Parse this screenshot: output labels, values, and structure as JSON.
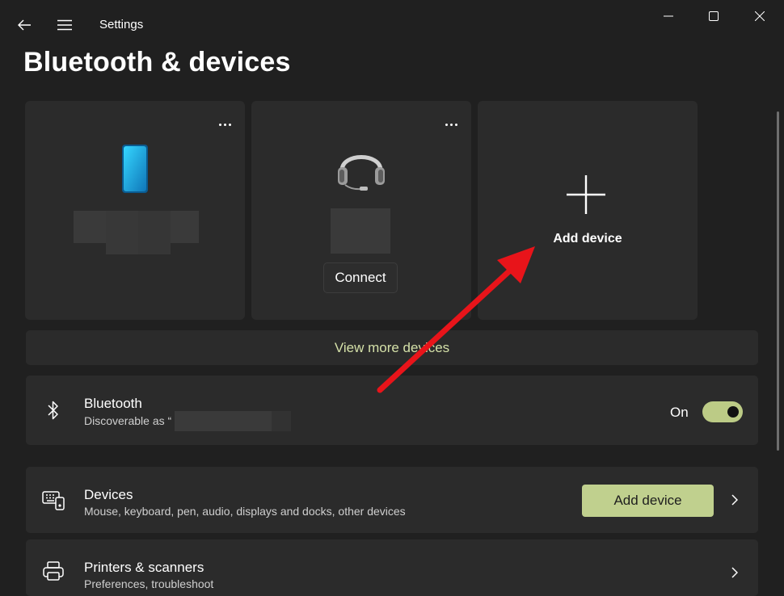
{
  "window": {
    "app_title": "Settings",
    "controls": [
      "minimize-icon",
      "maximize-icon",
      "close-icon"
    ]
  },
  "page": {
    "title": "Bluetooth & devices"
  },
  "device_cards": [
    {
      "type": "phone",
      "icon": "phone-icon",
      "name": ""
    },
    {
      "type": "headset",
      "icon": "headset-icon",
      "name": "",
      "action": "Connect"
    }
  ],
  "add_device_card": {
    "label": "Add device",
    "icon": "plus-icon"
  },
  "view_more": {
    "label": "View more devices"
  },
  "bluetooth": {
    "title": "Bluetooth",
    "subtitle": "Discoverable as “",
    "state_label": "On",
    "enabled": true
  },
  "devices_row": {
    "title": "Devices",
    "subtitle": "Mouse, keyboard, pen, audio, displays and docks, other devices",
    "button": "Add device"
  },
  "printers_row": {
    "title": "Printers & scanners",
    "subtitle": "Preferences, troubleshoot"
  },
  "colors": {
    "background": "#202020",
    "card": "#2b2b2b",
    "accent": "#c0d08e",
    "link_text": "#d4e0a8",
    "annotation_arrow": "#e8141a"
  }
}
